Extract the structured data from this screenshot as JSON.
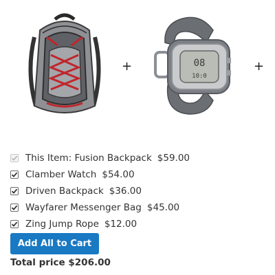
{
  "products": {
    "images": [
      {
        "name": "backpack-image"
      },
      {
        "name": "watch-image"
      }
    ],
    "separator": "+"
  },
  "items": [
    {
      "label": "This Item: Fusion Backpack",
      "price": "$59.00",
      "checked": true,
      "disabled": true
    },
    {
      "label": "Clamber Watch",
      "price": "$54.00",
      "checked": true,
      "disabled": false
    },
    {
      "label": "Driven Backpack",
      "price": "$36.00",
      "checked": true,
      "disabled": false
    },
    {
      "label": "Wayfarer Messenger Bag",
      "price": "$45.00",
      "checked": true,
      "disabled": false
    },
    {
      "label": "Zing Jump Rope",
      "price": "$12.00",
      "checked": true,
      "disabled": false
    }
  ],
  "actions": {
    "add_all_label": "Add All to Cart"
  },
  "total": {
    "label": "Total price $206.00"
  },
  "colors": {
    "primary_button": "#1979c3",
    "text": "#333333"
  }
}
